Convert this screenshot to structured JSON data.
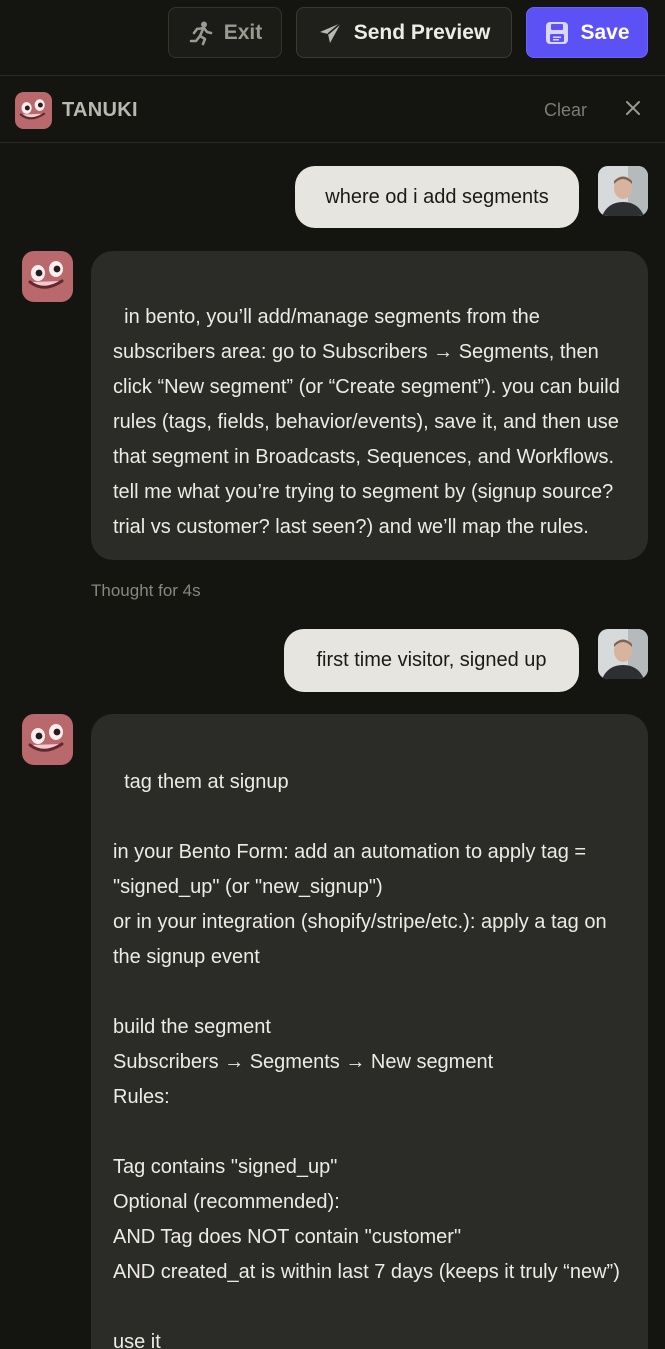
{
  "toolbar": {
    "exit_label": "Exit",
    "preview_label": "Send Preview",
    "save_label": "Save",
    "accent": "#5b51f5"
  },
  "header": {
    "title": "TANUKI",
    "clear_label": "Clear",
    "close_icon": "close-icon"
  },
  "messages": [
    {
      "role": "user",
      "text": "where od i add segments"
    },
    {
      "role": "assistant",
      "text": "in bento, you’ll add/manage segments from the subscribers area: go to Subscribers → Segments, then click “New segment” (or “Create segment”). you can build rules (tags, fields, behavior/events), save it, and then use that segment in Broadcasts, Sequences, and Workflows. tell me what you’re trying to segment by (signup source? trial vs customer? last seen?) and we’ll map the rules."
    },
    {
      "role": "status",
      "text": "Thought for 4s"
    },
    {
      "role": "user",
      "text": "first time visitor, signed up"
    },
    {
      "role": "assistant",
      "text": "tag them at signup\n\nin your Bento Form: add an automation to apply tag = \"signed_up\" (or \"new_signup\")\nor in your integration (shopify/stripe/etc.): apply a tag on the signup event\n\nbuild the segment\nSubscribers → Segments → New segment\nRules:\n\nTag contains \"signed_up\"\nOptional (recommended):\nAND Tag does NOT contain \"customer\"\nAND created_at is within last 7 days (keeps it truly “new”)\n\nuse it"
    }
  ]
}
